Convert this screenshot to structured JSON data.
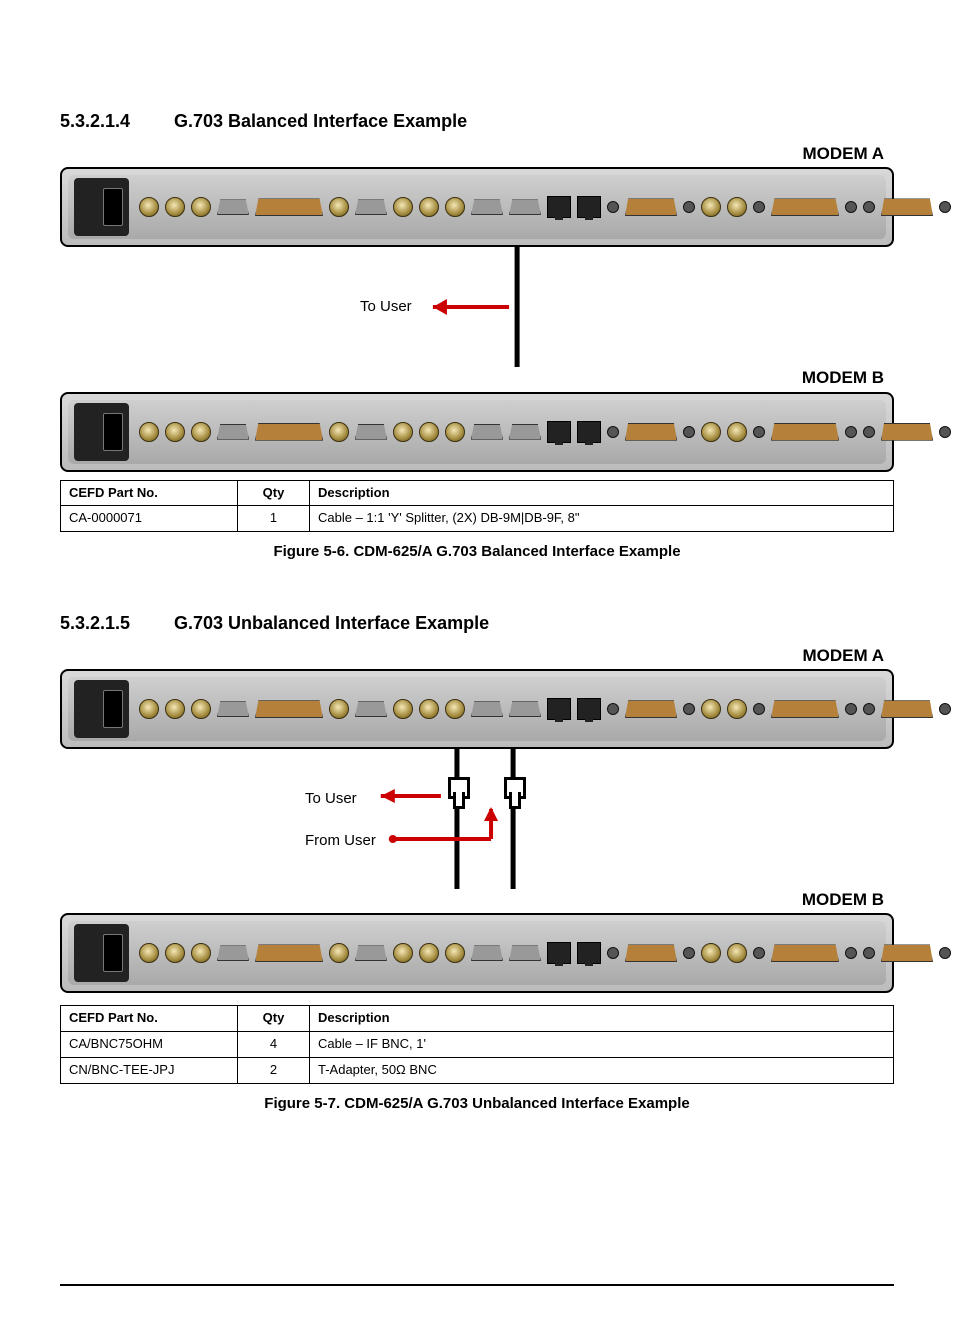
{
  "section1": {
    "num": "5.3.2.1.4",
    "title": "G.703 Balanced Interface Example",
    "modem_a_label": "MODEM A",
    "modem_b_label": "MODEM B",
    "to_user_label": "To User",
    "table": {
      "headers": [
        "CEFD Part No.",
        "Qty",
        "Description"
      ],
      "rows": [
        {
          "pn": "CA-0000071",
          "qty": "1",
          "desc": "Cable – 1:1 'Y' Splitter, (2X) DB-9M|DB-9F, 8\""
        }
      ]
    },
    "caption": "Figure 5-6. CDM-625/A G.703 Balanced Interface Example"
  },
  "section2": {
    "num": "5.3.2.1.5",
    "title": "G.703 Unbalanced Interface Example",
    "modem_a_label": "MODEM A",
    "modem_b_label": "MODEM B",
    "to_user_label": "To User",
    "from_user_label": "From User",
    "table": {
      "headers": [
        "CEFD Part No.",
        "Qty",
        "Description"
      ],
      "rows": [
        {
          "pn": "CA/BNC75OHM",
          "qty": "4",
          "desc": "Cable – IF BNC, 1'"
        },
        {
          "pn": "CN/BNC-TEE-JPJ",
          "qty": "2",
          "desc": "T-Adapter, 50Ω BNC"
        }
      ]
    },
    "caption": "Figure 5-7. CDM-625/A G.703 Unbalanced Interface Example"
  }
}
